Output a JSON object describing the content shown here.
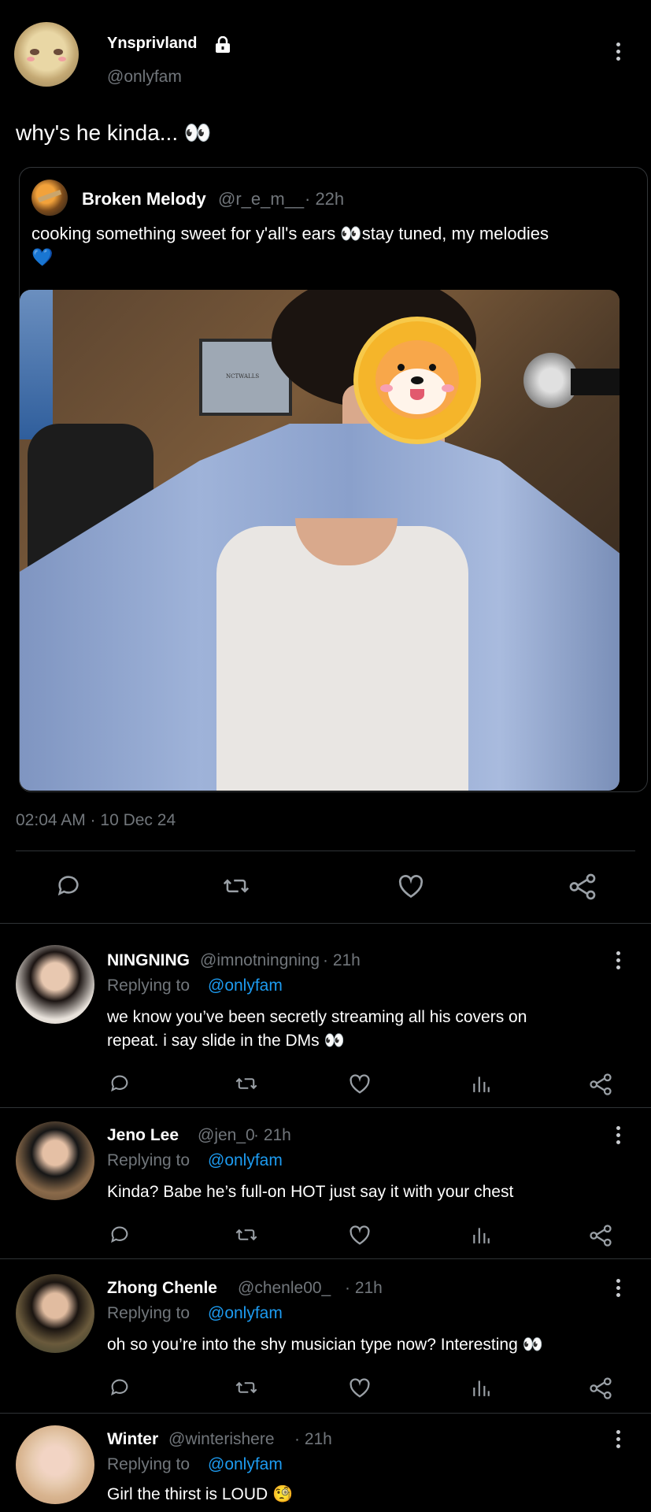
{
  "post": {
    "author_name": "Ynsprivland",
    "author_handle": "@onlyfam",
    "text": "why's he kinda... 👀",
    "timestamp": "02:04 AM · 10 Dec 24"
  },
  "quoted": {
    "author_name": "Broken Melody",
    "author_handle": "@r_e_m__",
    "time": "· 22h",
    "text_line1": "cooking something sweet for y'all's ears 👀stay tuned, my melodies",
    "text_line2": "💙",
    "mic_label": "NCTWALLS"
  },
  "replies": [
    {
      "name": "NINGNING",
      "handle": "@imnotningning",
      "time": "· 21h",
      "replying_prefix": "Replying to",
      "replying_to": "@onlyfam",
      "text_line1": "we know you’ve been secretly streaming all his covers on",
      "text_line2": "repeat. i say slide in the DMs 👀"
    },
    {
      "name": "Jeno Lee",
      "handle": "@jen_0",
      "time": "· 21h",
      "replying_prefix": "Replying to",
      "replying_to": "@onlyfam",
      "text_line1": "Kinda? Babe he’s full-on HOT just say it with your chest"
    },
    {
      "name": "Zhong Chenle",
      "handle": "@chenle00_",
      "time": "· 21h",
      "replying_prefix": "Replying to",
      "replying_to": "@onlyfam",
      "text_line1": "oh so you’re into the shy musician type now? Interesting 👀"
    },
    {
      "name": "Winter",
      "handle": "@winterishere",
      "time": "· 21h",
      "replying_prefix": "Replying to",
      "replying_to": "@onlyfam",
      "text_line1": "Girl the thirst is LOUD 🧐"
    }
  ],
  "icons": [
    "lock-icon",
    "more-icon",
    "reply-icon",
    "retweet-icon",
    "like-icon",
    "share-icon",
    "views-icon"
  ],
  "colors": {
    "background": "#000000",
    "link": "#1d9bf0",
    "muted": "#71767b",
    "divider": "#2f3336"
  }
}
